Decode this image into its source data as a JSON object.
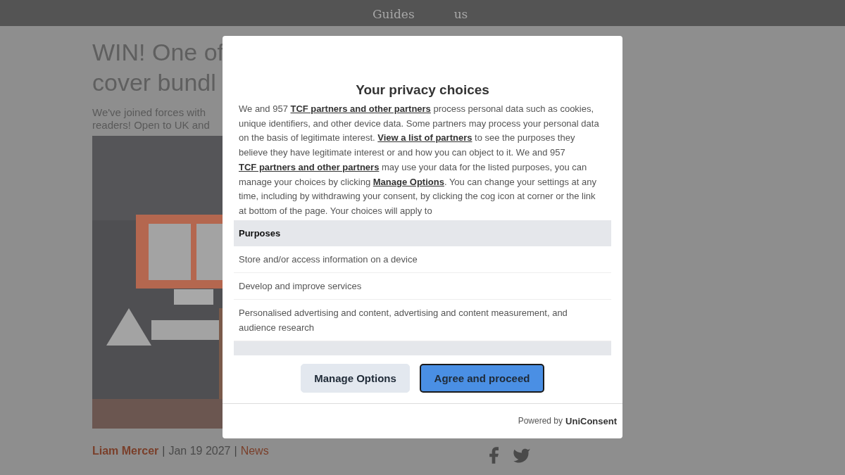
{
  "nav": {
    "items": [
      "Guides",
      "us"
    ]
  },
  "article": {
    "headline_lines": [
      "WIN! One of",
      "cover bundl"
    ],
    "intro_lines": [
      "We've joined forces with",
      "readers! Open to UK and"
    ],
    "picture": {
      "kind": "picture"
    },
    "byline": {
      "author": "Liam Mercer",
      "separator_1": "|",
      "date": "Jan 19 2027",
      "separator_2": "|",
      "category": "News"
    },
    "share": [
      {
        "kind": "facebook"
      },
      {
        "kind": "twitter"
      }
    ]
  },
  "dialog": {
    "title": "Your privacy choices",
    "body": [
      {
        "kind": "text",
        "text": "We and 957 "
      },
      {
        "kind": "link",
        "text": "TCF partners and other partners"
      },
      {
        "kind": "text",
        "text": " process personal data such as cookies, unique identifiers, and other device data. Some partners may process your personal data on the basis of legitimate interest. "
      },
      {
        "kind": "link",
        "text": "View a list of partners"
      },
      {
        "kind": "text",
        "text": " to see the purposes they believe they have legitimate interest or and how you can object to it. We and 957 "
      },
      {
        "kind": "link",
        "text": "TCF partners and other partners"
      },
      {
        "kind": "text",
        "text": " may use your data for the listed purposes, you can manage your choices by clicking "
      },
      {
        "kind": "link",
        "text": "Manage Options"
      },
      {
        "kind": "text",
        "text": ". You can change your settings at any time, including by withdrawing your consent, by clicking the cog icon at corner or the link at bottom of the page. Your choices will apply to"
      }
    ],
    "sections": [
      {
        "heading": "Purposes",
        "items": [
          "Store and/or access information on a device",
          "Develop and improve services",
          "Personalised advertising and content, advertising and content measurement, and audience research"
        ]
      }
    ],
    "buttons": [
      {
        "label": "Manage Options",
        "kind": "secondary"
      },
      {
        "label": "Agree and proceed",
        "kind": "primary"
      }
    ],
    "footer": {
      "prefix": "Powered by",
      "brand": "UniConsent"
    }
  }
}
